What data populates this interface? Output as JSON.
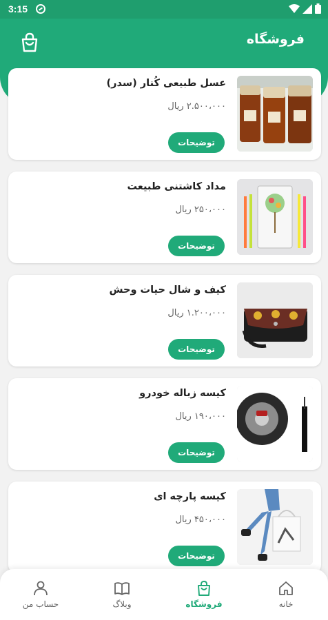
{
  "status_bar": {
    "time": "3:15"
  },
  "header": {
    "title": "فروشگاه"
  },
  "products": [
    {
      "name": "عسل طبیعی کُنار (سدر)",
      "price": "۲.۵۰۰،۰۰۰ ریال",
      "button": "توضیحات",
      "image": "honey-jars"
    },
    {
      "name": "مداد کاشتنی طبیعت",
      "price": "۲۵۰،۰۰۰ ریال",
      "button": "توضیحات",
      "image": "plantable-pencils"
    },
    {
      "name": "کیف و شال حیات وحش",
      "price": "۱.۲۰۰،۰۰۰ ریال",
      "button": "توضیحات",
      "image": "wildlife-bag"
    },
    {
      "name": "کیسه زباله خودرو",
      "price": "۱۹۰،۰۰۰ ریال",
      "button": "توضیحات",
      "image": "car-trash-bag"
    },
    {
      "name": "کیسه پارچه ای",
      "price": "۴۵۰،۰۰۰ ریال",
      "button": "توضیحات",
      "image": "cloth-bag"
    }
  ],
  "nav": {
    "items": [
      {
        "label": "خانه",
        "icon": "home-icon"
      },
      {
        "label": "فروشگاه",
        "icon": "shop-bag-icon"
      },
      {
        "label": "وبلاگ",
        "icon": "book-icon"
      },
      {
        "label": "حساب من",
        "icon": "user-icon"
      }
    ]
  },
  "colors": {
    "primary": "#20aa79",
    "status_bar": "#1f9e6e"
  }
}
